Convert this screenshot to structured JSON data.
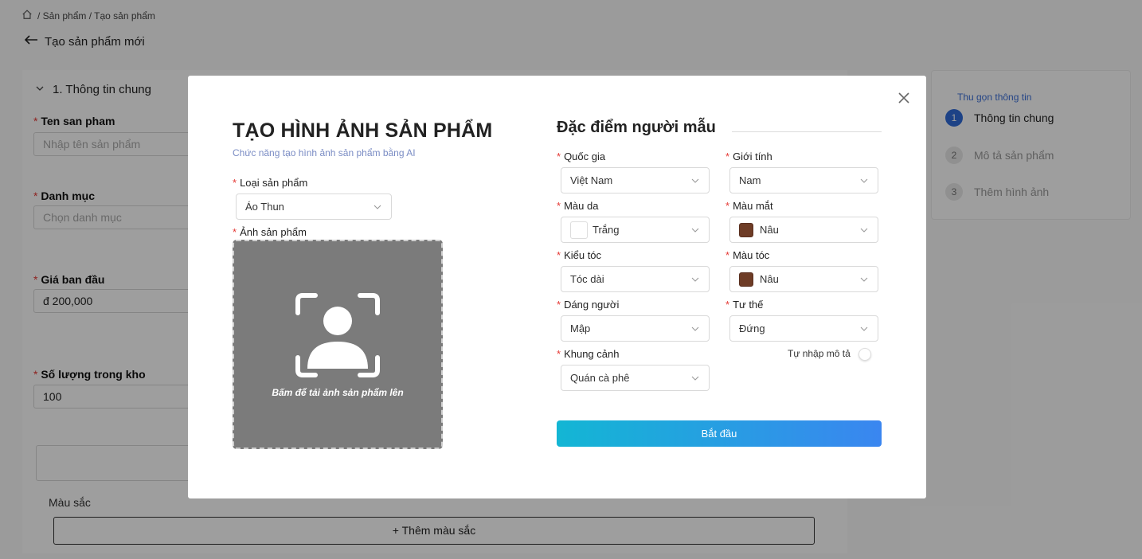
{
  "breadcrumb": {
    "path": "/ Sản phẩm / Tạo sản phẩm"
  },
  "page": {
    "back_title": "Tạo sản phẩm mới"
  },
  "form": {
    "section_title": "1.  Thông tin chung",
    "name_label": "Ten san pham",
    "name_placeholder": "Nhập tên sản phẩm",
    "category_label": "Danh mục",
    "category_placeholder": "Chọn danh mục",
    "price_label": "Giá ban đầu",
    "price_value": "đ 200,000",
    "stock_label": "Số lượng trong kho",
    "stock_value": "100",
    "color_label": "Màu sắc",
    "add_color_button": "+ Thêm màu sắc"
  },
  "sidebar": {
    "collapse_label": "Thu gọn thông tin",
    "steps": [
      {
        "num": "1",
        "label": "Thông tin chung"
      },
      {
        "num": "2",
        "label": "Mô tả sản phẩm"
      },
      {
        "num": "3",
        "label": "Thêm hình ảnh"
      }
    ]
  },
  "modal": {
    "title": "TẠO HÌNH ẢNH SẢN PHẨM",
    "subtitle": "Chức năng tạo hình ảnh sản phẩm bằng AI",
    "product_type": {
      "label": "Loại sản phẩm",
      "value": "Áo Thun"
    },
    "product_image": {
      "label": "Ảnh sản phẩm",
      "upload_text": "Bấm để tải ảnh sản phẩm lên"
    },
    "model_title": "Đặc điểm người mẫu",
    "country": {
      "label": "Quốc gia",
      "value": "Việt Nam"
    },
    "gender": {
      "label": "Giới tính",
      "value": "Nam"
    },
    "skin": {
      "label": "Màu da",
      "value": "Trắng",
      "color": "#ffffff"
    },
    "eyes": {
      "label": "Màu mắt",
      "value": "Nâu",
      "color": "#6e3c26"
    },
    "hair_style": {
      "label": "Kiểu tóc",
      "value": "Tóc dài"
    },
    "hair_color": {
      "label": "Màu tóc",
      "value": "Nâu",
      "color": "#6e3c26"
    },
    "body": {
      "label": "Dáng người",
      "value": "Mập"
    },
    "pose": {
      "label": "Tư thế",
      "value": "Đứng"
    },
    "scene": {
      "label": "Khung cảnh",
      "value": "Quán cà phê"
    },
    "custom_desc_label": "Tự nhập mô tả",
    "start_button": "Bắt đầu"
  },
  "colors": {
    "accent": "#2f6bd8",
    "button_gradient_start": "#13b6d4",
    "button_gradient_end": "#3a86f0",
    "required": "#e53935"
  }
}
